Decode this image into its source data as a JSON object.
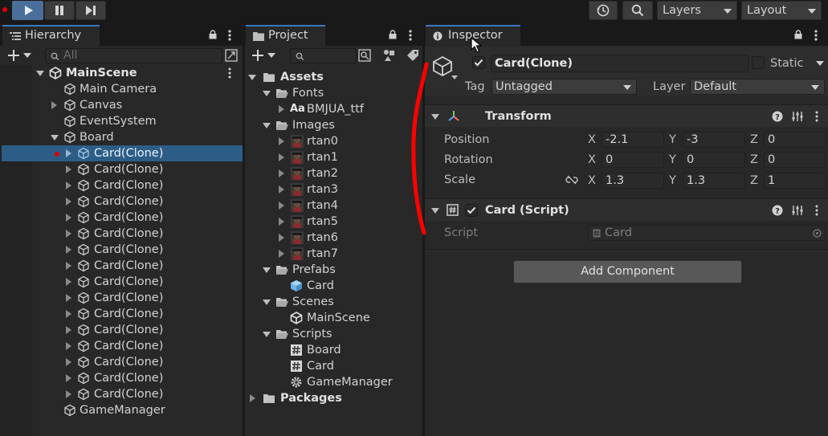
{
  "toolbar": {
    "layers_label": "Layers",
    "layout_label": "Layout"
  },
  "hierarchy": {
    "tab_label": "Hierarchy",
    "search_placeholder": "All",
    "scene_name": "MainScene",
    "items": [
      {
        "label": "Main Camera"
      },
      {
        "label": "Canvas"
      },
      {
        "label": "EventSystem"
      },
      {
        "label": "Board"
      },
      {
        "label": "GameManager"
      }
    ],
    "board_children": [
      "Card(Clone)",
      "Card(Clone)",
      "Card(Clone)",
      "Card(Clone)",
      "Card(Clone)",
      "Card(Clone)",
      "Card(Clone)",
      "Card(Clone)",
      "Card(Clone)",
      "Card(Clone)",
      "Card(Clone)",
      "Card(Clone)",
      "Card(Clone)",
      "Card(Clone)",
      "Card(Clone)",
      "Card(Clone)"
    ]
  },
  "project": {
    "tab_label": "Project",
    "assets_label": "Assets",
    "packages_label": "Packages",
    "fonts_label": "Fonts",
    "font_file": "BMJUA_ttf",
    "font_badge": "Aa",
    "images_label": "Images",
    "images": [
      "rtan0",
      "rtan1",
      "rtan2",
      "rtan3",
      "rtan4",
      "rtan5",
      "rtan6",
      "rtan7"
    ],
    "prefabs_label": "Prefabs",
    "prefab_card": "Card",
    "scenes_label": "Scenes",
    "scene_file": "MainScene",
    "scripts_label": "Scripts",
    "scripts": [
      "Board",
      "Card",
      "GameManager"
    ]
  },
  "inspector": {
    "tab_label": "Inspector",
    "object_name": "Card(Clone)",
    "static_label": "Static",
    "tag_label": "Tag",
    "tag_value": "Untagged",
    "layer_label": "Layer",
    "layer_value": "Default",
    "transform_title": "Transform",
    "position_label": "Position",
    "rotation_label": "Rotation",
    "scale_label": "Scale",
    "axis_x": "X",
    "axis_y": "Y",
    "axis_z": "Z",
    "position": {
      "x": "-2.1",
      "y": "-3",
      "z": "0"
    },
    "rotation": {
      "x": "0",
      "y": "0",
      "z": "0"
    },
    "scale": {
      "x": "1.3",
      "y": "1.3",
      "z": "1"
    },
    "script_component_title": "Card (Script)",
    "script_label": "Script",
    "script_value": "Card",
    "add_component_label": "Add Component"
  },
  "colors": {
    "selection": "#2c5d87",
    "accent_tab": "#3a79bb",
    "play_active": "#4a6f9a",
    "annotation_red": "#ff0000"
  }
}
